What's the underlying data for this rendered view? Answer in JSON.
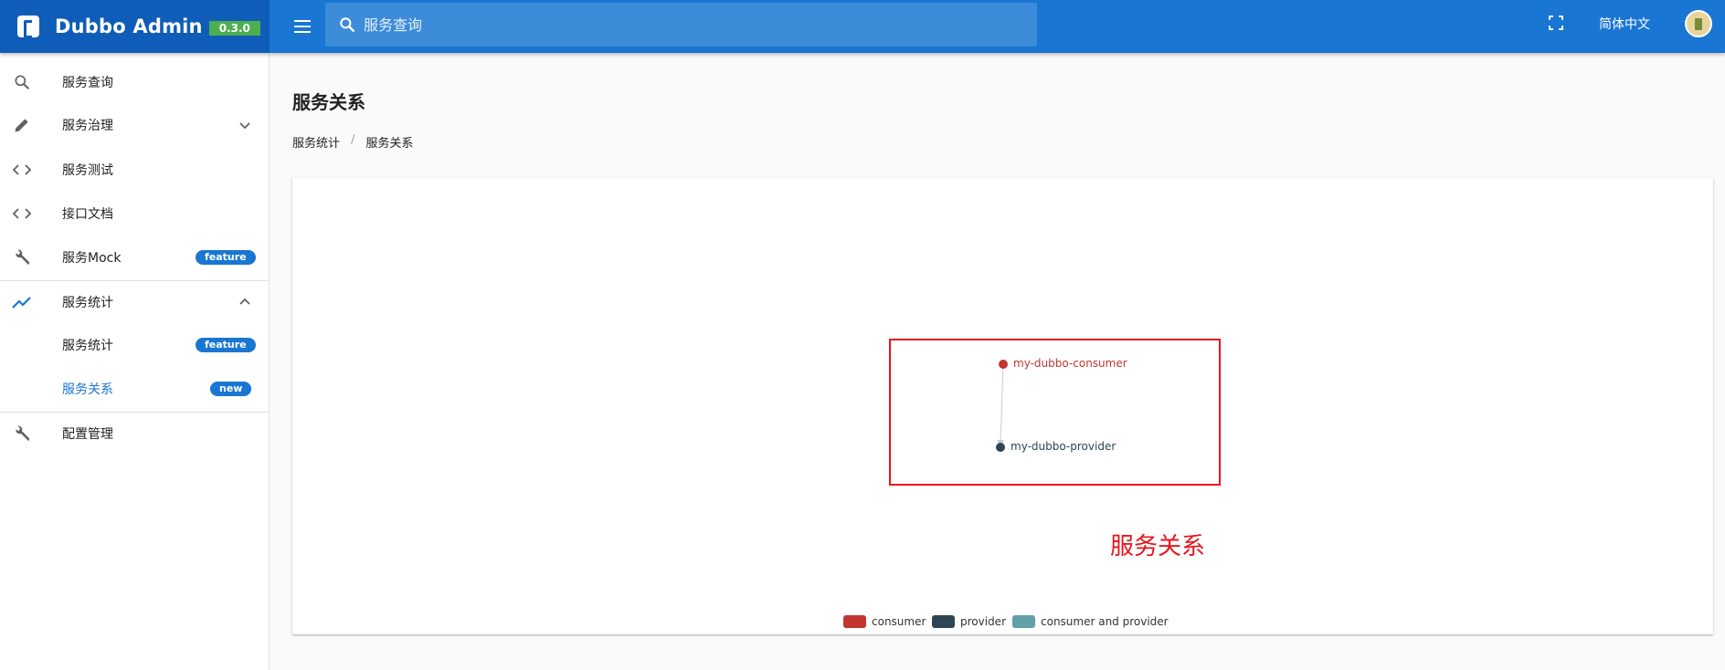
{
  "header": {
    "brand_title": "Dubbo Admin",
    "version": "0.3.0",
    "search_placeholder": "服务查询",
    "language": "简体中文"
  },
  "sidebar": {
    "items": [
      {
        "label": "服务查询",
        "icon": "search-icon"
      },
      {
        "label": "服务治理",
        "icon": "pencil-icon"
      },
      {
        "label": "服务测试",
        "icon": "code-icon"
      },
      {
        "label": "接口文档",
        "icon": "code-icon"
      },
      {
        "label": "服务Mock",
        "icon": "wrench-icon",
        "badge": "feature"
      },
      {
        "label": "服务统计",
        "icon": "trending-up-icon"
      },
      {
        "label": "服务统计",
        "badge": "feature"
      },
      {
        "label": "服务关系",
        "badge": "new"
      },
      {
        "label": "配置管理",
        "icon": "wrench-icon"
      }
    ]
  },
  "main": {
    "title": "服务关系",
    "breadcrumb": [
      "服务统计",
      "服务关系"
    ],
    "annotation": "服务关系"
  },
  "graph": {
    "nodes": [
      {
        "name": "my-dubbo-consumer",
        "category": "consumer"
      },
      {
        "name": "my-dubbo-provider",
        "category": "provider"
      }
    ],
    "edges": [
      {
        "source": "my-dubbo-consumer",
        "target": "my-dubbo-provider"
      }
    ],
    "legend": [
      {
        "label": "consumer",
        "color": "#c23531"
      },
      {
        "label": "provider",
        "color": "#2f4554"
      },
      {
        "label": "consumer and provider",
        "color": "#61a0a8"
      }
    ]
  },
  "colors": {
    "primary": "#1976d2",
    "brand_bg": "#0f5db8",
    "version_badge": "#4caf50",
    "annotation_red": "#e8141c"
  }
}
